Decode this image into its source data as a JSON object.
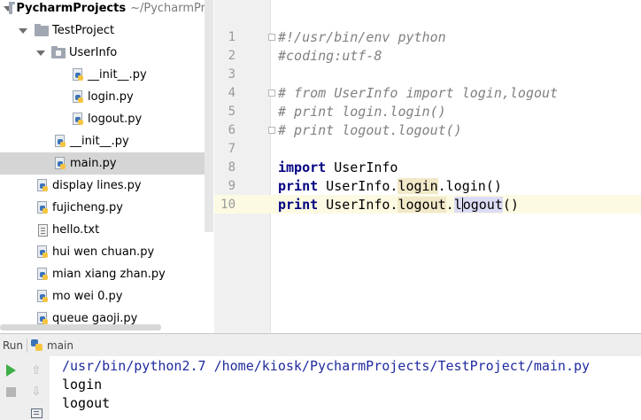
{
  "project_tree": {
    "root": {
      "label": "PycharmProjects",
      "hint": "~/PycharmPr"
    },
    "items": [
      {
        "label": "TestProject"
      },
      {
        "label": "UserInfo"
      },
      {
        "label": "__init__.py"
      },
      {
        "label": "login.py"
      },
      {
        "label": "logout.py"
      },
      {
        "label": "__init__.py"
      },
      {
        "label": "main.py"
      },
      {
        "label": "display lines.py"
      },
      {
        "label": "fujicheng.py"
      },
      {
        "label": "hello.txt"
      },
      {
        "label": "hui wen chuan.py"
      },
      {
        "label": "mian xiang zhan.py"
      },
      {
        "label": "mo wei 0.py"
      },
      {
        "label": "queue gaoji.py"
      }
    ]
  },
  "editor": {
    "line_numbers": [
      "1",
      "2",
      "3",
      "4",
      "5",
      "6",
      "7",
      "8",
      "9",
      "10"
    ],
    "lines": {
      "l1": "#!/usr/bin/env python",
      "l2": "#coding:utf-8",
      "l4": "# from UserInfo import login,logout",
      "l5": "# print login.login()",
      "l6": "# print logout.logout()",
      "l8_kw": "import",
      "l8_rest": " UserInfo",
      "l9_kw": "print",
      "l9_a": " UserInfo.",
      "l9_ref": "login",
      "l9_b": ".login()",
      "l10_kw": "print",
      "l10_a": " UserInfo.",
      "l10_ref": "logout",
      "l10_dot": ".",
      "l10_c1": "l",
      "l10_c2": "ogout",
      "l10_end": "()"
    }
  },
  "run_panel": {
    "title": "Run",
    "tab_label": "main",
    "output": [
      "/usr/bin/python2.7 /home/kiosk/PycharmProjects/TestProject/main.py",
      "login",
      "logout"
    ]
  },
  "icons": {
    "run": "run-play-icon",
    "stop": "stop-icon",
    "up": "scroll-up-icon",
    "down": "scroll-down-icon",
    "console": "console-settings-icon"
  }
}
